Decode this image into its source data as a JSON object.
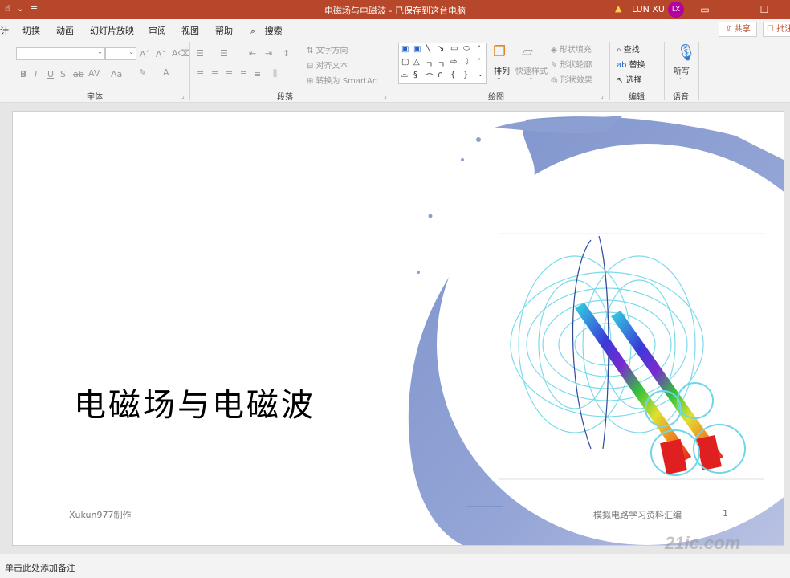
{
  "titlebar": {
    "doc_title": "电磁场与电磁波 - 已保存到这台电脑",
    "user_name": "LUN XU",
    "avatar_initials": "LX",
    "warning_glyph": "▲"
  },
  "menu": {
    "tabs": [
      "计",
      "切换",
      "动画",
      "幻灯片放映",
      "审阅",
      "视图",
      "帮助"
    ],
    "search_label": "搜索",
    "share_label": "共享",
    "comment_label": "批注"
  },
  "ribbon": {
    "font_group": "字体",
    "paragraph_group": "段落",
    "drawing_group": "绘图",
    "editing_group": "编辑",
    "voice_group": "语音",
    "text_direction": "文字方向",
    "align_text": "对齐文本",
    "convert_smartart": "转换为 SmartArt",
    "arrange": "排列",
    "quick_styles": "快速样式",
    "shape_fill": "形状填充",
    "shape_outline": "形状轮廓",
    "shape_effects": "形状效果",
    "find": "查找",
    "replace": "替换",
    "select": "选择",
    "dictate": "听写",
    "font_buttons": [
      "B",
      "I",
      "U",
      "S",
      "ab",
      "AV",
      "Aa"
    ]
  },
  "slide": {
    "title": "电磁场与电磁波",
    "footer_left": "Xukun977制作",
    "footer_center": "模拟电路学习资料汇编",
    "slide_number": "1"
  },
  "statusbar": {
    "notes_placeholder": "单击此处添加备注"
  },
  "watermark": "21ic.com",
  "colors": {
    "titlebar": "#b7472a",
    "accent_ring": "#8a9fd0",
    "avatar": "#b4009e"
  }
}
